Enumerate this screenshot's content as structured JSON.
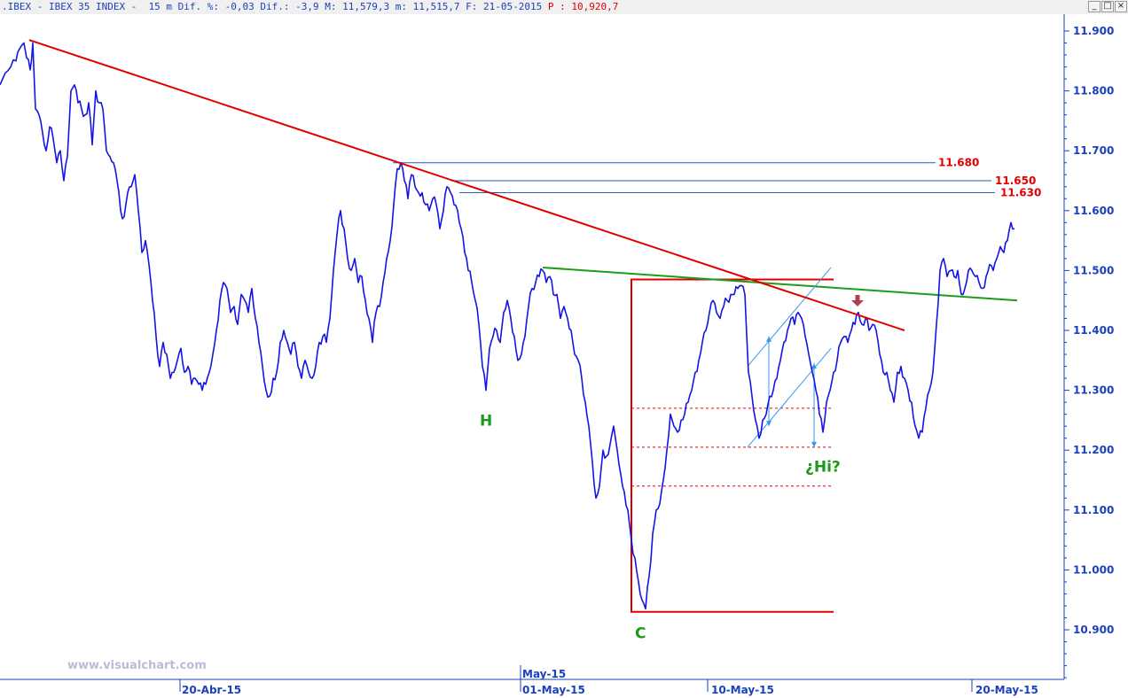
{
  "window": {
    "title_main": ".IBEX - IBEX 35 INDEX -  15 m Dif. %: -0,03 Dif.: -3,9 M: 11,579,3 m: 11,515,7 F: 21-05-2015",
    "title_price": "P : 10,920,7",
    "buttons": {
      "minimize": "_",
      "restore": "□",
      "close": "×"
    }
  },
  "watermark": "www.visualchart.com",
  "colors": {
    "price": "#1414e6",
    "red_line": "#e00000",
    "green_line": "#1a9e1a",
    "level_line": "#1f5fbf",
    "axis_text": "#1a3fbf",
    "label_red": "#e00000",
    "label_green": "#1b9a1b",
    "channel": "#3399ee",
    "arrow_marker": "#b04050"
  },
  "chart_data": {
    "type": "line",
    "instrument": "IBEX 35 INDEX",
    "interval": "15 m",
    "y_ticks": [
      "11.900",
      "11.800",
      "11.700",
      "11.600",
      "11.500",
      "11.400",
      "11.300",
      "11.200",
      "11.100",
      "11.000",
      "10.900"
    ],
    "ylim": [
      10830,
      11930
    ],
    "x_ticks": [
      "20-Abr-15",
      "May-15",
      "01-May-15",
      "10-May-15",
      "20-May-15"
    ],
    "series": [
      {
        "points": [
          [
            0,
            11810
          ],
          [
            6,
            11830
          ],
          [
            12,
            11840
          ],
          [
            18,
            11850
          ],
          [
            22,
            11870
          ],
          [
            27,
            11880
          ],
          [
            30,
            11855
          ],
          [
            34,
            11835
          ],
          [
            37,
            11880
          ],
          [
            40,
            11770
          ],
          [
            44,
            11760
          ],
          [
            48,
            11730
          ],
          [
            52,
            11700
          ],
          [
            56,
            11740
          ],
          [
            60,
            11720
          ],
          [
            64,
            11680
          ],
          [
            68,
            11700
          ],
          [
            72,
            11650
          ],
          [
            76,
            11690
          ],
          [
            80,
            11800
          ],
          [
            84,
            11810
          ],
          [
            88,
            11780
          ],
          [
            92,
            11770
          ],
          [
            96,
            11760
          ],
          [
            100,
            11780
          ],
          [
            104,
            11710
          ],
          [
            108,
            11800
          ],
          [
            112,
            11780
          ],
          [
            116,
            11770
          ],
          [
            120,
            11700
          ],
          [
            124,
            11690
          ],
          [
            128,
            11680
          ],
          [
            132,
            11650
          ],
          [
            136,
            11600
          ],
          [
            140,
            11590
          ],
          [
            144,
            11630
          ],
          [
            148,
            11640
          ],
          [
            152,
            11660
          ],
          [
            156,
            11600
          ],
          [
            160,
            11530
          ],
          [
            164,
            11550
          ],
          [
            168,
            11510
          ],
          [
            172,
            11450
          ],
          [
            176,
            11390
          ],
          [
            180,
            11340
          ],
          [
            184,
            11380
          ],
          [
            188,
            11360
          ],
          [
            192,
            11320
          ],
          [
            196,
            11330
          ],
          [
            200,
            11350
          ],
          [
            204,
            11370
          ],
          [
            208,
            11330
          ],
          [
            212,
            11340
          ],
          [
            216,
            11310
          ],
          [
            220,
            11320
          ],
          [
            224,
            11310
          ],
          [
            228,
            11300
          ],
          [
            232,
            11310
          ],
          [
            236,
            11330
          ],
          [
            240,
            11360
          ],
          [
            244,
            11400
          ],
          [
            248,
            11450
          ],
          [
            252,
            11480
          ],
          [
            256,
            11470
          ],
          [
            260,
            11430
          ],
          [
            264,
            11440
          ],
          [
            268,
            11410
          ],
          [
            272,
            11460
          ],
          [
            276,
            11450
          ],
          [
            280,
            11430
          ],
          [
            284,
            11470
          ],
          [
            288,
            11420
          ],
          [
            292,
            11380
          ],
          [
            296,
            11340
          ],
          [
            300,
            11300
          ],
          [
            304,
            11290
          ],
          [
            308,
            11320
          ],
          [
            312,
            11330
          ],
          [
            316,
            11380
          ],
          [
            320,
            11400
          ],
          [
            324,
            11380
          ],
          [
            328,
            11360
          ],
          [
            332,
            11380
          ],
          [
            336,
            11340
          ],
          [
            340,
            11320
          ],
          [
            344,
            11350
          ],
          [
            348,
            11330
          ],
          [
            352,
            11320
          ],
          [
            356,
            11340
          ],
          [
            360,
            11380
          ],
          [
            364,
            11390
          ],
          [
            368,
            11380
          ],
          [
            372,
            11420
          ],
          [
            376,
            11500
          ],
          [
            380,
            11560
          ],
          [
            384,
            11600
          ],
          [
            388,
            11570
          ],
          [
            392,
            11520
          ],
          [
            396,
            11500
          ],
          [
            400,
            11520
          ],
          [
            404,
            11480
          ],
          [
            408,
            11490
          ],
          [
            412,
            11450
          ],
          [
            416,
            11420
          ],
          [
            420,
            11380
          ],
          [
            424,
            11430
          ],
          [
            428,
            11440
          ],
          [
            432,
            11480
          ],
          [
            436,
            11520
          ],
          [
            440,
            11550
          ],
          [
            444,
            11610
          ],
          [
            448,
            11670
          ],
          [
            452,
            11680
          ],
          [
            456,
            11650
          ],
          [
            460,
            11620
          ],
          [
            464,
            11660
          ],
          [
            468,
            11640
          ],
          [
            472,
            11630
          ],
          [
            476,
            11630
          ],
          [
            480,
            11610
          ],
          [
            484,
            11600
          ],
          [
            488,
            11620
          ],
          [
            492,
            11610
          ],
          [
            496,
            11570
          ],
          [
            500,
            11600
          ],
          [
            504,
            11640
          ],
          [
            508,
            11630
          ],
          [
            512,
            11610
          ],
          [
            516,
            11600
          ],
          [
            520,
            11570
          ],
          [
            524,
            11530
          ],
          [
            528,
            11500
          ],
          [
            532,
            11480
          ],
          [
            536,
            11450
          ],
          [
            540,
            11410
          ],
          [
            544,
            11340
          ],
          [
            548,
            11300
          ],
          [
            552,
            11370
          ],
          [
            556,
            11390
          ],
          [
            560,
            11400
          ],
          [
            564,
            11380
          ],
          [
            568,
            11430
          ],
          [
            572,
            11450
          ],
          [
            576,
            11420
          ],
          [
            580,
            11390
          ],
          [
            584,
            11350
          ],
          [
            588,
            11360
          ],
          [
            592,
            11390
          ],
          [
            596,
            11440
          ],
          [
            600,
            11470
          ],
          [
            604,
            11480
          ],
          [
            608,
            11490
          ],
          [
            612,
            11500
          ],
          [
            616,
            11480
          ],
          [
            620,
            11490
          ],
          [
            624,
            11460
          ],
          [
            628,
            11460
          ],
          [
            632,
            11420
          ],
          [
            636,
            11440
          ],
          [
            640,
            11420
          ],
          [
            644,
            11400
          ],
          [
            648,
            11360
          ],
          [
            652,
            11350
          ],
          [
            656,
            11320
          ],
          [
            660,
            11280
          ],
          [
            664,
            11240
          ],
          [
            668,
            11180
          ],
          [
            672,
            11120
          ],
          [
            676,
            11140
          ],
          [
            680,
            11200
          ],
          [
            684,
            11190
          ],
          [
            688,
            11210
          ],
          [
            692,
            11240
          ],
          [
            696,
            11200
          ],
          [
            700,
            11160
          ],
          [
            704,
            11130
          ],
          [
            708,
            11100
          ],
          [
            712,
            11050
          ],
          [
            716,
            11020
          ],
          [
            720,
            10980
          ],
          [
            724,
            10950
          ],
          [
            728,
            10935
          ],
          [
            732,
            10990
          ],
          [
            736,
            11060
          ],
          [
            740,
            11100
          ],
          [
            744,
            11110
          ],
          [
            748,
            11150
          ],
          [
            752,
            11200
          ],
          [
            756,
            11260
          ],
          [
            760,
            11240
          ],
          [
            764,
            11230
          ],
          [
            768,
            11250
          ],
          [
            772,
            11260
          ],
          [
            776,
            11280
          ],
          [
            780,
            11300
          ],
          [
            784,
            11330
          ],
          [
            788,
            11350
          ],
          [
            792,
            11380
          ],
          [
            796,
            11400
          ],
          [
            800,
            11430
          ],
          [
            804,
            11450
          ],
          [
            808,
            11430
          ],
          [
            812,
            11420
          ],
          [
            816,
            11440
          ],
          [
            820,
            11450
          ],
          [
            824,
            11460
          ],
          [
            828,
            11460
          ],
          [
            832,
            11470
          ],
          [
            836,
            11475
          ],
          [
            840,
            11460
          ],
          [
            844,
            11330
          ],
          [
            848,
            11290
          ],
          [
            852,
            11250
          ],
          [
            856,
            11220
          ],
          [
            860,
            11250
          ],
          [
            864,
            11260
          ],
          [
            868,
            11290
          ],
          [
            872,
            11300
          ],
          [
            876,
            11320
          ],
          [
            880,
            11350
          ],
          [
            884,
            11380
          ],
          [
            888,
            11400
          ],
          [
            892,
            11420
          ],
          [
            896,
            11410
          ],
          [
            900,
            11430
          ],
          [
            904,
            11420
          ],
          [
            908,
            11390
          ],
          [
            912,
            11360
          ],
          [
            916,
            11330
          ],
          [
            920,
            11300
          ],
          [
            924,
            11260
          ],
          [
            928,
            11230
          ],
          [
            932,
            11280
          ],
          [
            936,
            11300
          ],
          [
            940,
            11330
          ],
          [
            944,
            11350
          ],
          [
            948,
            11380
          ],
          [
            952,
            11390
          ],
          [
            956,
            11380
          ],
          [
            960,
            11400
          ],
          [
            964,
            11410
          ],
          [
            968,
            11430
          ],
          [
            972,
            11410
          ],
          [
            976,
            11420
          ],
          [
            980,
            11400
          ],
          [
            984,
            11410
          ],
          [
            988,
            11400
          ],
          [
            992,
            11360
          ],
          [
            996,
            11330
          ],
          [
            1000,
            11330
          ],
          [
            1004,
            11300
          ],
          [
            1008,
            11280
          ],
          [
            1012,
            11330
          ],
          [
            1016,
            11340
          ],
          [
            1020,
            11320
          ],
          [
            1024,
            11300
          ],
          [
            1028,
            11280
          ],
          [
            1032,
            11240
          ],
          [
            1036,
            11220
          ],
          [
            1040,
            11230
          ],
          [
            1044,
            11270
          ],
          [
            1048,
            11300
          ],
          [
            1052,
            11330
          ],
          [
            1056,
            11410
          ],
          [
            1060,
            11500
          ],
          [
            1064,
            11520
          ],
          [
            1068,
            11490
          ],
          [
            1072,
            11500
          ],
          [
            1076,
            11490
          ],
          [
            1080,
            11500
          ],
          [
            1084,
            11460
          ],
          [
            1088,
            11470
          ],
          [
            1092,
            11500
          ],
          [
            1096,
            11500
          ],
          [
            1100,
            11490
          ],
          [
            1104,
            11480
          ],
          [
            1108,
            11470
          ],
          [
            1112,
            11490
          ],
          [
            1116,
            11510
          ],
          [
            1120,
            11500
          ],
          [
            1124,
            11520
          ],
          [
            1128,
            11540
          ],
          [
            1132,
            11530
          ],
          [
            1136,
            11550
          ],
          [
            1140,
            11580
          ],
          [
            1144,
            11570
          ]
        ]
      }
    ],
    "horizontal_levels": [
      {
        "value": 11680,
        "label": "11.680"
      },
      {
        "value": 11650,
        "label": "11.650"
      },
      {
        "value": 11630,
        "label": "11.630"
      }
    ],
    "annotations": {
      "wave_labels": [
        "H",
        "C",
        "¿Hi?"
      ],
      "trendline_red": [
        [
          33,
          11885
        ],
        [
          1020,
          11400
        ]
      ],
      "trendline_green": [
        [
          612,
          11505
        ],
        [
          1147,
          11450
        ]
      ],
      "projection_box": {
        "x1": 712,
        "x2": 940,
        "y_top": 11485,
        "y_bottom": 10930
      },
      "dotted_levels": [
        11270,
        11205,
        11140
      ],
      "arrow_marker_at": [
        967,
        11440
      ]
    }
  }
}
